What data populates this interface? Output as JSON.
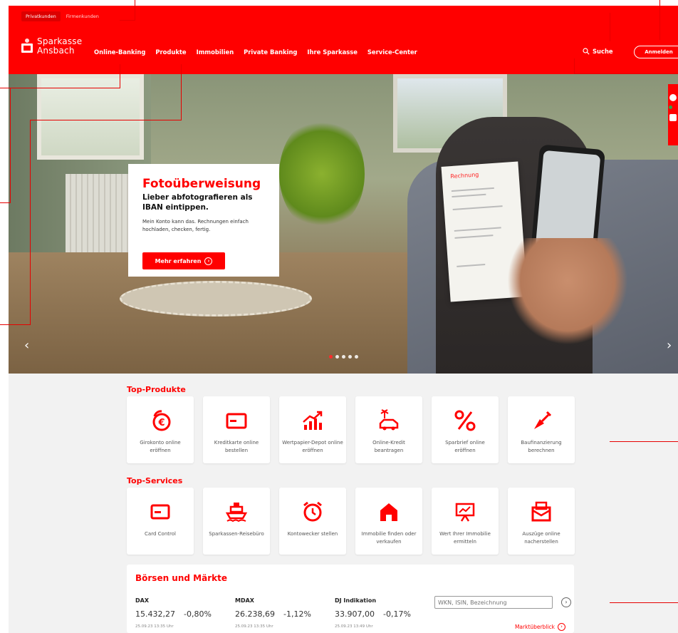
{
  "header": {
    "target_tabs": [
      "Privatkunden",
      "Firmenkunden"
    ],
    "logo": {
      "line1": "Sparkasse",
      "line2": "Ansbach"
    },
    "nav": [
      "Online-Banking",
      "Produkte",
      "Immobilien",
      "Private Banking",
      "Ihre Sparkasse",
      "Service-Center"
    ],
    "search_label": "Suche",
    "login_label": "Anmelden"
  },
  "hero": {
    "title": "Fotoüberweisung",
    "subtitle": "Lieber abfotografieren als IBAN eintippen.",
    "text": "Mein Konto kann das. Rechnungen einfach hochladen, checken, fertig.",
    "button": "Mehr erfahren",
    "invoice_word": "Rechnung",
    "slide_count": 5,
    "active_slide": 1
  },
  "top_products": {
    "title": "Top-Produkte",
    "items": [
      {
        "label": "Girokonto online eröffnen",
        "icon": "euro-coin-icon"
      },
      {
        "label": "Kreditkarte online bestellen",
        "icon": "credit-card-icon"
      },
      {
        "label": "Wertpapier-Depot online eröffnen",
        "icon": "stock-chart-icon"
      },
      {
        "label": "Online-Kredit beantragen",
        "icon": "car-palm-icon"
      },
      {
        "label": "Sparbrief online eröffnen",
        "icon": "percent-icon"
      },
      {
        "label": "Baufinanzierung berechnen",
        "icon": "trowel-icon"
      }
    ]
  },
  "top_services": {
    "title": "Top-Services",
    "items": [
      {
        "label": "Card Control",
        "icon": "card-icon"
      },
      {
        "label": "Sparkassen-Reisebüro",
        "icon": "ship-icon"
      },
      {
        "label": "Kontowecker stellen",
        "icon": "alarm-clock-icon"
      },
      {
        "label": "Immobilie finden oder verkaufen",
        "icon": "house-icon"
      },
      {
        "label": "Wert Ihrer Immobilie ermitteln",
        "icon": "presentation-icon"
      },
      {
        "label": "Auszüge online nacherstellen",
        "icon": "envelope-icon"
      }
    ]
  },
  "market": {
    "title": "Börsen und Märkte",
    "indices": [
      {
        "name": "DAX",
        "value": "15.432,27",
        "change": "-0,80%",
        "time": "25.09.23 13:35 Uhr"
      },
      {
        "name": "MDAX",
        "value": "26.238,69",
        "change": "-1,12%",
        "time": "25.09.23 13:35 Uhr"
      },
      {
        "name": "DJ Indikation",
        "value": "33.907,00",
        "change": "-0,17%",
        "time": "25.09.23 13:49 Uhr"
      }
    ],
    "search_placeholder": "WKN, ISIN, Bezeichnung",
    "overview_link": "Marktüberblick"
  },
  "colors": {
    "brand_red": "#ff0000",
    "background": "#f2f2f2"
  }
}
